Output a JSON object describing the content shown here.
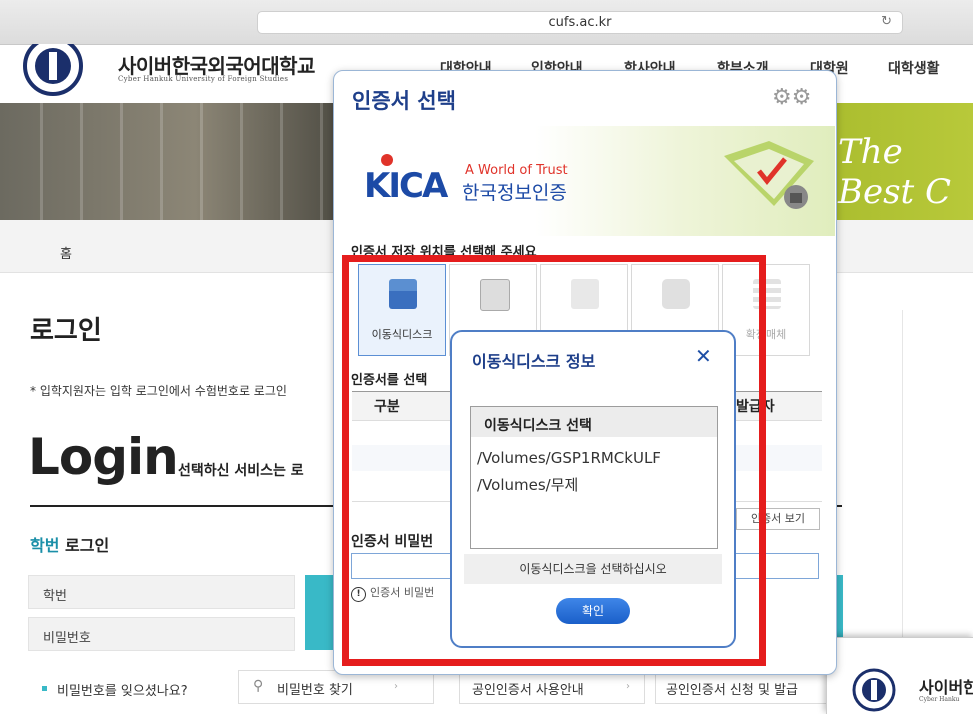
{
  "browser": {
    "url": "cufs.ac.kr",
    "reload_icon": "reload-icon"
  },
  "site": {
    "name_kr": "사이버한국외국어대학교",
    "name_en": "Cyber Hankuk University of Foreign Studies",
    "nav": [
      "대학안내",
      "입학안내",
      "학사안내",
      "학부소개",
      "대학원",
      "대학생활"
    ],
    "banner_slogan": "The Best C"
  },
  "breadcrumb": {
    "home": "홈"
  },
  "page": {
    "title": "로그인",
    "notice": "* 입학지원자는 입학 로그인에서 수험번호로 로그인",
    "login_heading": "Login",
    "login_sub": "선택하신 서비스는 로",
    "hakbun_highlight": "학번",
    "hakbun_rest": " 로그인",
    "field_id": "학번",
    "field_pw": "비밀번호",
    "forgot": "비밀번호를 잊으셨나요?",
    "find_btn": "비밀번호 찾기",
    "cert_guide_btn": "공인인증서 사용안내",
    "cert_issue_btn": "공인인증서 신청 및 발급"
  },
  "cert_dialog": {
    "title": "인증서 선택",
    "kica_logo": "KICA",
    "kica_slogan": "A World of Trust",
    "kica_name": "한국정보인증",
    "store_label": "인증서 저장 위치를 선택해 주세요",
    "tiles": [
      {
        "label": "이동식디스크",
        "selected": true
      },
      {
        "label": ""
      },
      {
        "label": ""
      },
      {
        "label": ""
      },
      {
        "label": "확장매체"
      }
    ],
    "choose_label": "인증서를 선택",
    "col_gubun": "구분",
    "col_issuer": "발급자",
    "view_cert": "인증서 보기",
    "pw_label": "인증서 비밀번",
    "pw_hint": "인증서 비밀번"
  },
  "usb_dialog": {
    "title": "이동식디스크 정보",
    "list_header": "이동식디스크 선택",
    "items": [
      "/Volumes/GSP1RMCkULF",
      "/Volumes/무제"
    ],
    "message": "이동식디스크을 선택하십시오",
    "confirm": "확인"
  },
  "thumb": {
    "name_kr": "사이버한",
    "name_en": "Cyber Hanku"
  },
  "colors": {
    "accent": "#39b9c7",
    "dialog_title": "#1e3f8a",
    "highlight": "#e51d1d"
  }
}
